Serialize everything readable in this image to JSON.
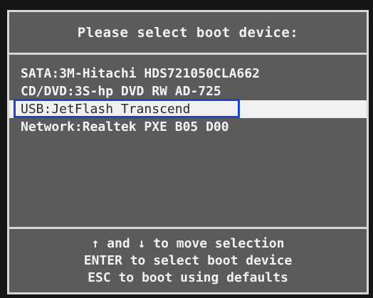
{
  "dialog": {
    "title": "Please select boot device:"
  },
  "devices": [
    {
      "label": "SATA:3M-Hitachi HDS721050CLA662"
    },
    {
      "label": "CD/DVD:3S-hp DVD RW AD-725"
    },
    {
      "label": "USB:JetFlash Transcend"
    },
    {
      "label": "Network:Realtek PXE B05 D00"
    }
  ],
  "footer": {
    "line1": "↑ and ↓ to move selection",
    "line2": "ENTER to select boot device",
    "line3": "ESC to boot using defaults"
  },
  "colors": {
    "dialog_bg": "#5b5b5b",
    "selection_bg": "#f0f0f0",
    "highlight_box": "#1e46c8"
  }
}
